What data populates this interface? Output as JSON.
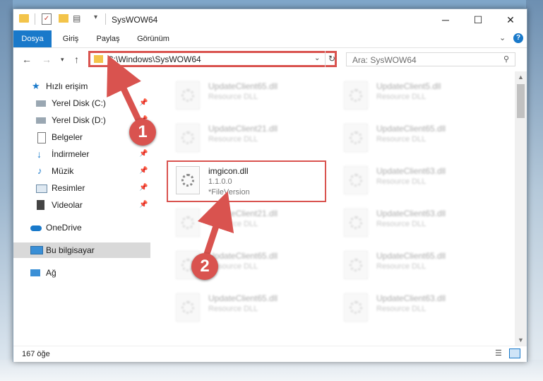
{
  "window": {
    "title": "SysWOW64",
    "controls": {
      "minimize": "─",
      "maximize": "☐",
      "close": "✕"
    }
  },
  "ribbon": {
    "tabs": [
      {
        "label": "Dosya",
        "active": true
      },
      {
        "label": "Giriş"
      },
      {
        "label": "Paylaş"
      },
      {
        "label": "Görünüm"
      }
    ],
    "help": "?"
  },
  "nav": {
    "address": "C:\\Windows\\SysWOW64",
    "search_placeholder": "Ara: SysWOW64"
  },
  "sidebar": {
    "items": [
      {
        "label": "Hızlı erişim",
        "icon": "star-icon"
      },
      {
        "label": "Yerel Disk (C:)",
        "icon": "drive-icon",
        "pinned": true
      },
      {
        "label": "Yerel Disk (D:)",
        "icon": "drive-icon",
        "pinned": true
      },
      {
        "label": "Belgeler",
        "icon": "document-icon",
        "pinned": true
      },
      {
        "label": "İndirmeler",
        "icon": "download-icon",
        "pinned": true
      },
      {
        "label": "Müzik",
        "icon": "music-icon",
        "pinned": true
      },
      {
        "label": "Resimler",
        "icon": "pictures-icon",
        "pinned": true
      },
      {
        "label": "Videolar",
        "icon": "video-icon",
        "pinned": true
      },
      {
        "label": "OneDrive",
        "icon": "cloud-icon"
      },
      {
        "label": "Bu bilgisayar",
        "icon": "computer-icon",
        "selected": true
      },
      {
        "label": "Ağ",
        "icon": "network-icon"
      }
    ]
  },
  "files": {
    "left": [
      {
        "name": "UpdateClient65.dll",
        "type": "Resource DLL"
      },
      {
        "name": "UpdateClient21.dll",
        "type": "Resource DLL"
      },
      {
        "name": "imgicon.dll",
        "version": "1.1.0.0",
        "type": "*FileVersion",
        "highlighted": true
      },
      {
        "name": "UpdateClient21.dll",
        "type": "Resource DLL"
      },
      {
        "name": "UpdateClient65.dll",
        "type": "Resource DLL"
      },
      {
        "name": "UpdateClient65.dll",
        "type": "Resource DLL"
      }
    ],
    "right": [
      {
        "name": "UpdateClient5.dll",
        "type": "Resource DLL"
      },
      {
        "name": "UpdateClient65.dll",
        "type": "Resource DLL"
      },
      {
        "name": "UpdateClient63.dll",
        "type": "Resource DLL"
      },
      {
        "name": "UpdateClient63.dll",
        "type": "Resource DLL"
      },
      {
        "name": "UpdateClient65.dll",
        "type": "Resource DLL"
      },
      {
        "name": "UpdateClient63.dll",
        "type": "Resource DLL"
      }
    ]
  },
  "status": {
    "count": "167 öğe"
  },
  "annotations": {
    "step1": "1",
    "step2": "2",
    "color": "#d9534f"
  }
}
